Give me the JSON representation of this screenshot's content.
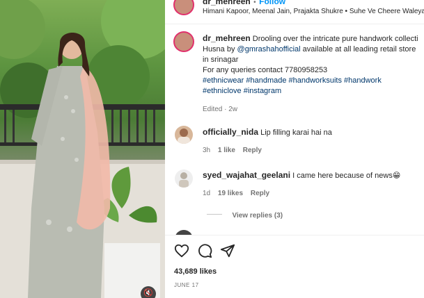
{
  "header": {
    "username": "dr_mehreen",
    "separator": "•",
    "follow_label": "Follow",
    "collab_text": "Himani Kapoor, Meenal Jain, Prajakta Shukre • Suhe Ve Cheere Waleya"
  },
  "caption": {
    "username": "dr_mehreen",
    "line1": "Drooling over the intricate pure handwork collecti",
    "line2_pre": "Husna by",
    "mention": "@gmrashahofficial",
    "line2_post": "available at all leading retail store",
    "line3": "in srinagar",
    "line4": "For any queries contact 7780958253",
    "hashtags_line1": "#ethnicwear #handmade #handworksuits #handwork",
    "hashtags_line2": "#ethniclove #instagram",
    "edited": "Edited · 2w"
  },
  "comments": [
    {
      "username": "officially_nida",
      "text": "Lip filling karai hai na",
      "time": "3h",
      "likes": "1 like",
      "reply": "Reply"
    },
    {
      "username": "syed_wajahat_geelani",
      "text": "I came here because of news😁",
      "time": "1d",
      "likes": "19 likes",
      "reply": "Reply",
      "view_replies": "View replies (3)"
    }
  ],
  "actions": {
    "likes": "43,689 likes",
    "date": "JUNE 17"
  },
  "colors": {
    "accent": "#0095f6",
    "link": "#00376b",
    "text": "#262626",
    "muted": "#737373",
    "ring": "#e1306c"
  },
  "icons": [
    "heart-icon",
    "comment-icon",
    "share-icon",
    "mute-icon"
  ]
}
